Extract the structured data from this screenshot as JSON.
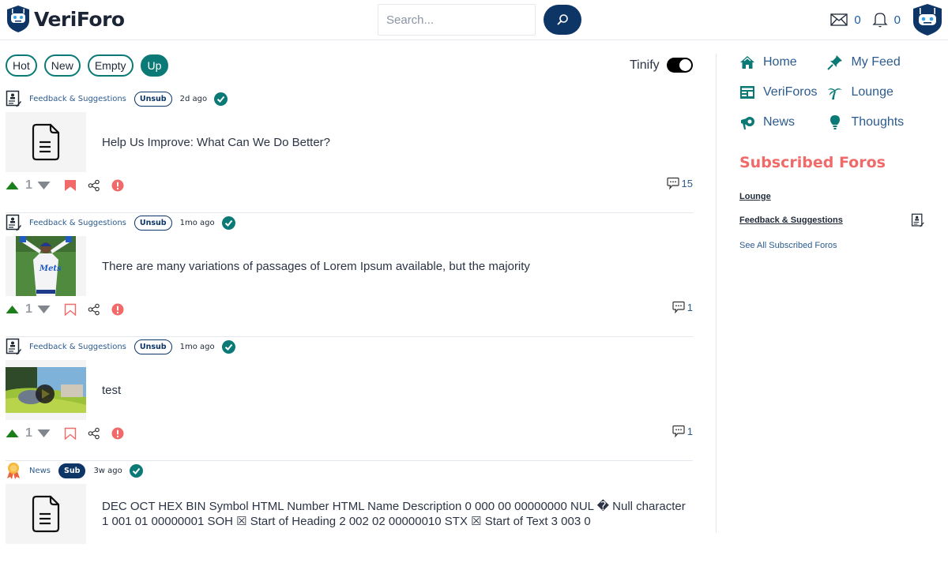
{
  "header": {
    "brand": "VeriForo",
    "search_placeholder": "Search...",
    "search_value": "",
    "messages_count": "0",
    "notifications_count": "0"
  },
  "filters": {
    "items": [
      {
        "label": "Hot",
        "active": false
      },
      {
        "label": "New",
        "active": false
      },
      {
        "label": "Empty",
        "active": false
      },
      {
        "label": "Up",
        "active": true
      }
    ],
    "tinify_label": "Tinify",
    "tinify_on": true
  },
  "posts": [
    {
      "forum": "Feedback & Suggestions",
      "forum_icon": "contact-edit-icon",
      "sub_label": "Unsub",
      "time": "2d ago",
      "verified": true,
      "thumb": "document-icon",
      "title": "Help Us Improve: What Can We Do Better?",
      "votes": "1",
      "bookmarked": true,
      "comments": "15"
    },
    {
      "forum": "Feedback & Suggestions",
      "forum_icon": "contact-edit-icon",
      "sub_label": "Unsub",
      "time": "1mo ago",
      "verified": true,
      "thumb": "baseball-player-image",
      "title": "There are many variations of passages of Lorem Ipsum available, but the majority",
      "votes": "1",
      "bookmarked": false,
      "comments": "1"
    },
    {
      "forum": "Feedback & Suggestions",
      "forum_icon": "contact-edit-icon",
      "sub_label": "Unsub",
      "time": "1mo ago",
      "verified": true,
      "thumb": "video-thumbnail",
      "title": "test",
      "votes": "1",
      "bookmarked": false,
      "comments": "1"
    },
    {
      "forum": "News",
      "forum_icon": "award-medal-icon",
      "sub_label": "Sub",
      "time": "3w ago",
      "verified": true,
      "thumb": "document-icon",
      "title": "DEC OCT HEX BIN Symbol HTML Number HTML Name Description 0 000 00 00000000 NUL � Null character 1 001 01 00000001 SOH ☒ Start of Heading 2 002 02 00000010 STX ☒ Start of Text 3 003 0"
    }
  ],
  "sidebar": {
    "nav": [
      {
        "label": "Home",
        "icon": "home-icon"
      },
      {
        "label": "My Feed",
        "icon": "pin-icon"
      },
      {
        "label": "VeriForos",
        "icon": "newspaper-icon"
      },
      {
        "label": "Lounge",
        "icon": "palm-tree-icon"
      },
      {
        "label": "News",
        "icon": "megaphone-icon"
      },
      {
        "label": "Thoughts",
        "icon": "lightbulb-icon"
      }
    ],
    "subscribed_title": "Subscribed Foros",
    "subscribed": [
      {
        "label": "Lounge"
      },
      {
        "label": "Feedback & Suggestions"
      }
    ],
    "see_all": "See All Subscribed Foros"
  },
  "colors": {
    "teal": "#0b7a77",
    "navy": "#0d3566",
    "coral": "#f06a6a",
    "link": "#2c5b8f",
    "upvote": "#1a7f1a"
  }
}
